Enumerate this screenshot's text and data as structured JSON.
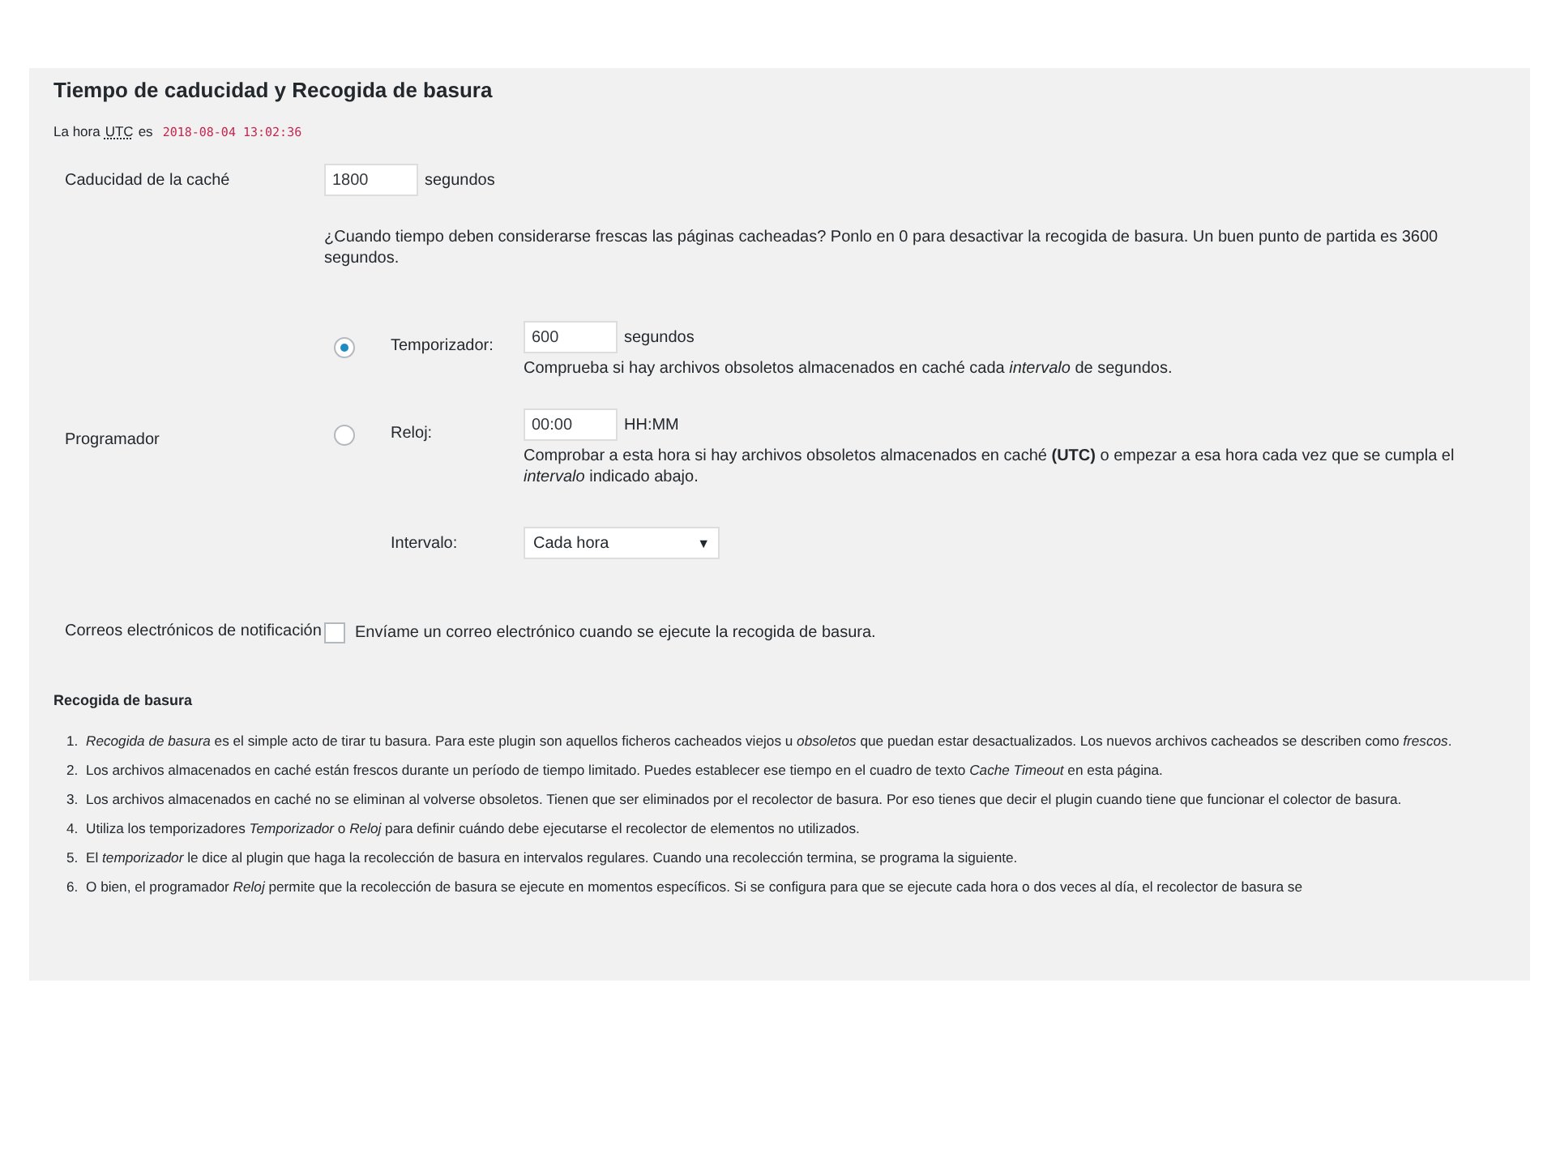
{
  "section_title": "Tiempo de caducidad y Recogida de basura",
  "utc": {
    "prefix": "La hora",
    "abbr": "UTC",
    "suffix": "es",
    "time": "2018-08-04 13:02:36"
  },
  "cache_expiry": {
    "label": "Caducidad de la caché",
    "value": "1800",
    "unit": "segundos",
    "description": "¿Cuando tiempo deben considerarse frescas las páginas cacheadas? Ponlo en 0 para desactivar la recogida de basura. Un buen punto de partida es 3600 segundos."
  },
  "scheduler": {
    "label": "Programador",
    "options": [
      {
        "label": "Temporizador:",
        "selected": true,
        "value": "600",
        "unit": "segundos",
        "description": "Comprueba si hay archivos obsoletos almacenados en caché cada *intervalo* de segundos."
      },
      {
        "label": "Reloj:",
        "selected": false,
        "value": "00:00",
        "unit": "HH:MM",
        "description": "Comprobar a esta hora si hay archivos obsoletos almacenados en caché **(UTC)** o empezar a esa hora cada vez que se cumpla el *intervalo* indicado abajo."
      }
    ],
    "interval": {
      "label": "Intervalo:",
      "value": "Cada hora",
      "arrow": "▼"
    }
  },
  "notifications": {
    "label": "Correos electrónicos de notificación",
    "checked": false,
    "text": "Envíame un correo electrónico cuando se ejecute la recogida de basura."
  },
  "help": {
    "title": "Recogida de basura",
    "items": [
      {
        "number": "1.",
        "text": "*Recogida de basura* es el simple acto de tirar tu basura. Para este plugin son aquellos ficheros cacheados viejos u *obsoletos* que puedan estar desactualizados. Los nuevos archivos cacheados se describen como *frescos*."
      },
      {
        "number": "2.",
        "text": "Los archivos almacenados en caché están frescos durante un período de tiempo limitado. Puedes establecer ese tiempo en el cuadro de texto *Cache Timeout* en esta página."
      },
      {
        "number": "3.",
        "text": "Los archivos almacenados en caché no se eliminan al volverse obsoletos. Tienen que ser eliminados por el recolector de basura. Por eso tienes que decir el plugin cuando tiene que funcionar el colector de basura."
      },
      {
        "number": "4.",
        "text": "Utiliza los temporizadores *Temporizador* o *Reloj* para definir cuándo debe ejecutarse el recolector de elementos no utilizados."
      },
      {
        "number": "5.",
        "text": "El *temporizador* le dice al plugin que haga la recolección de basura en intervalos regulares. Cuando una recolección termina, se programa la siguiente."
      },
      {
        "number": "6.",
        "text": "O bien, el programador *Reloj* permite que la recolección de basura se ejecute en momentos específicos. Si se configura para que se ejecute cada hora o dos veces al día, el recolector de basura se"
      }
    ]
  }
}
